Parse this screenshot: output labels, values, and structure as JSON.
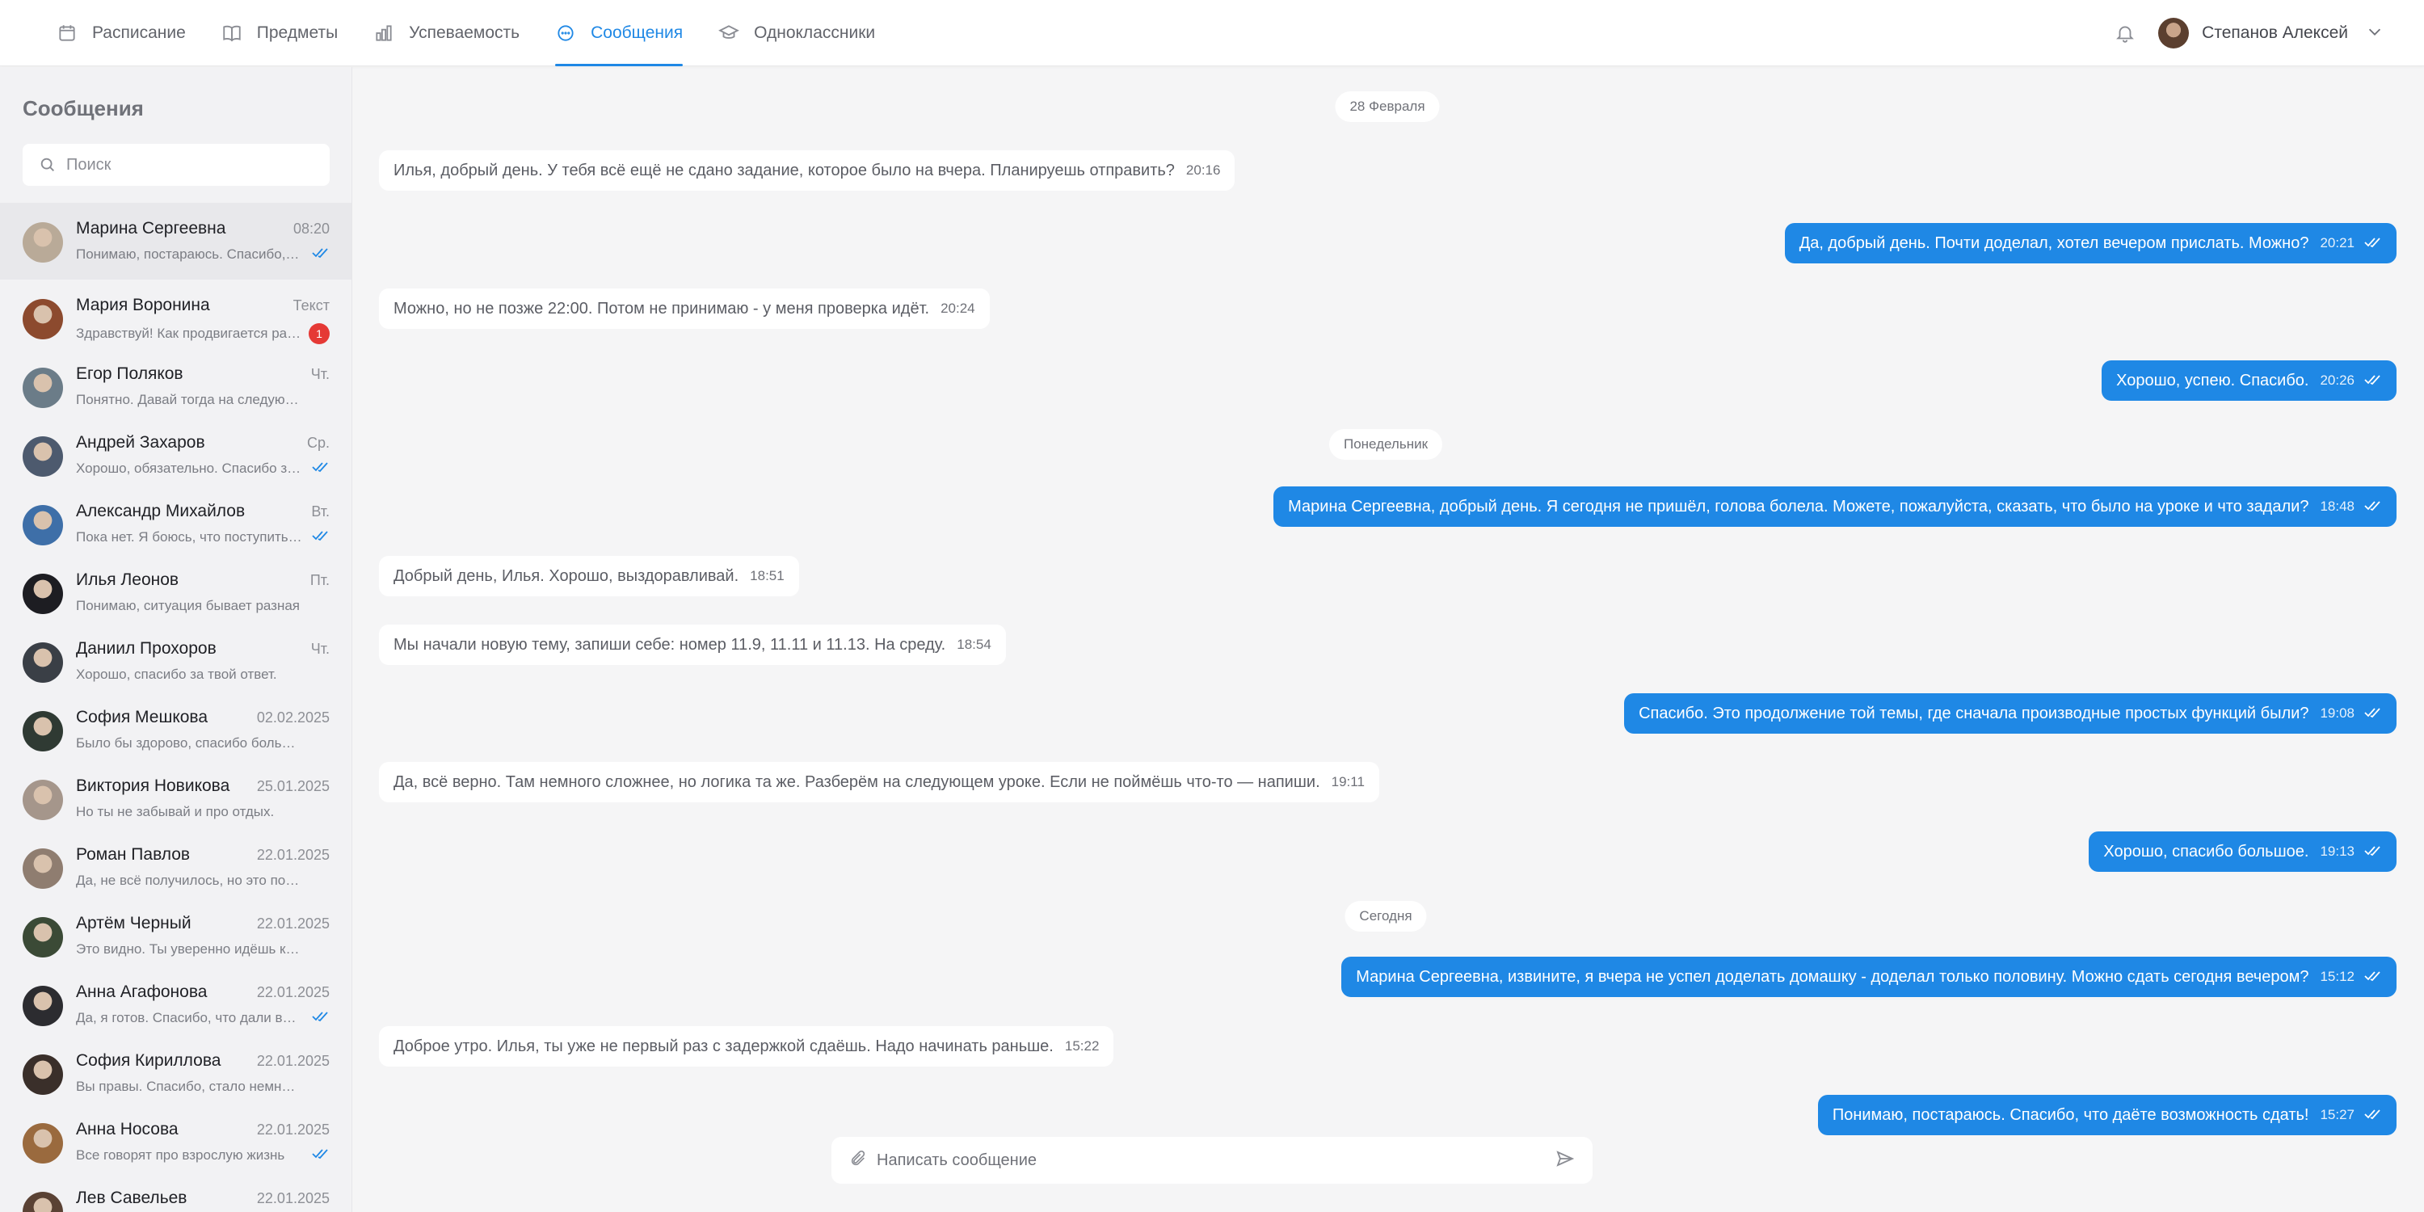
{
  "nav": {
    "items": [
      {
        "label": "Расписание",
        "icon": "calendar-icon"
      },
      {
        "label": "Предметы",
        "icon": "book-icon"
      },
      {
        "label": "Успеваемость",
        "icon": "bar-chart-icon"
      },
      {
        "label": "Сообщения",
        "icon": "chat-icon",
        "active": true
      },
      {
        "label": "Одноклассники",
        "icon": "graduation-cap-icon"
      }
    ]
  },
  "user": {
    "name": "Степанов Алексей"
  },
  "sidebar": {
    "title": "Сообщения",
    "search_placeholder": "Поиск",
    "chats": [
      {
        "name": "Марина Сергеевна",
        "time": "08:20",
        "preview": "Понимаю, постараюсь. Спасибо, что даёте возможность сдать!",
        "status": "read",
        "avatar": "#b9aa98"
      },
      {
        "name": "Мария Воронина",
        "time": "Текст",
        "preview": "Здравствуй! Как продвигается работа над проектом?",
        "unread": "1",
        "avatar": "#8c4a2e"
      },
      {
        "name": "Егор Поляков",
        "time": "Чт.",
        "preview": "Понятно. Давай тогда на следующей неделе",
        "avatar": "#6b7c88"
      },
      {
        "name": "Андрей Захаров",
        "time": "Ср.",
        "preview": "Хорошо, обязательно. Спасибо за помощь",
        "status": "read",
        "avatar": "#4d5a6e"
      },
      {
        "name": "Александр Михайлов",
        "time": "Вт.",
        "preview": "Пока нет. Я боюсь, что поступить не получится",
        "status": "read",
        "avatar": "#3e6fa8"
      },
      {
        "name": "Илья Леонов",
        "time": "Пт.",
        "preview": "Понимаю, ситуация бывает разная",
        "avatar": "#1d1d22"
      },
      {
        "name": "Даниил Прохоров",
        "time": "Чт.",
        "preview": "Хорошо, спасибо за твой ответ.",
        "avatar": "#3a3f46"
      },
      {
        "name": "София Мешкова",
        "time": "02.02.2025",
        "preview": "Было бы здорово, спасибо большое!",
        "avatar": "#2f3a33"
      },
      {
        "name": "Виктория Новикова",
        "time": "25.01.2025",
        "preview": "Но ты не забывай и про отдых.",
        "avatar": "#a5968b"
      },
      {
        "name": "Роман Павлов",
        "time": "22.01.2025",
        "preview": "Да, не всё получилось, но это поправимо",
        "avatar": "#8f7d70"
      },
      {
        "name": "Артём Черный",
        "time": "22.01.2025",
        "preview": "Это видно. Ты уверенно идёшь к своей цели",
        "avatar": "#3b4a36"
      },
      {
        "name": "Анна Агафонова",
        "time": "22.01.2025",
        "preview": "Да, я готов. Спасибо, что дали время",
        "status": "read",
        "avatar": "#2c2c30"
      },
      {
        "name": "София Кириллова",
        "time": "22.01.2025",
        "preview": "Вы правы. Спасибо, стало немного легче",
        "avatar": "#3a2f2a"
      },
      {
        "name": "Анна Носова",
        "time": "22.01.2025",
        "preview": "Все говорят про взрослую жизнь",
        "status": "read",
        "avatar": "#9a6a3e"
      },
      {
        "name": "Лев Савельев",
        "time": "22.01.2025",
        "preview": "",
        "avatar": "#5a4234"
      }
    ]
  },
  "conversation": {
    "dates": [
      "28 Февраля",
      "Понедельник",
      "Сегодня"
    ],
    "messages": [
      {
        "dir": "in",
        "text": "Илья, добрый день. У тебя всё ещё не сдано задание, которое было на вчера. Планируешь отправить?",
        "time": "20:16"
      },
      {
        "dir": "out",
        "text": "Да, добрый день. Почти доделал, хотел вечером прислать. Можно?",
        "time": "20:21"
      },
      {
        "dir": "in",
        "text": "Можно, но не позже 22:00. Потом не принимаю - у меня проверка идёт.",
        "time": "20:24"
      },
      {
        "dir": "out",
        "text": "Хорошо, успею. Спасибо.",
        "time": "20:26"
      },
      {
        "dir": "out",
        "text": "Марина Сергеевна, добрый день. Я сегодня не пришёл, голова болела. Можете, пожалуйста, сказать, что было на уроке и что задали?",
        "time": "18:48"
      },
      {
        "dir": "in",
        "text": "Добрый день, Илья. Хорошо, выздоравливай.",
        "time": "18:51"
      },
      {
        "dir": "in",
        "text": "Мы начали новую тему, запиши себе: номер 11.9, 11.11 и 11.13. На среду.",
        "time": "18:54"
      },
      {
        "dir": "out",
        "text": "Спасибо. Это продолжение той темы, где сначала производные простых функций были?",
        "time": "19:08"
      },
      {
        "dir": "in",
        "text": "Да, всё верно. Там немного сложнее, но логика та же. Разберём на следующем уроке. Если не поймёшь что-то — напиши.",
        "time": "19:11"
      },
      {
        "dir": "out",
        "text": "Хорошо, спасибо большое.",
        "time": "19:13"
      },
      {
        "dir": "out",
        "text": "Марина Сергеевна, извините, я вчера не успел доделать домашку - доделал только половину. Можно сдать сегодня вечером?",
        "time": "15:12"
      },
      {
        "dir": "in",
        "text": "Доброе утро. Илья, ты уже не первый раз с задержкой сдаёшь. Надо начинать раньше.",
        "time": "15:22"
      },
      {
        "dir": "out",
        "text": "Понимаю, постараюсь. Спасибо, что даёте возможность сдать!",
        "time": "15:27"
      }
    ]
  },
  "composer": {
    "placeholder": "Написать сообщение"
  },
  "colors": {
    "accent": "#1f88e5",
    "badge": "#e53935"
  }
}
